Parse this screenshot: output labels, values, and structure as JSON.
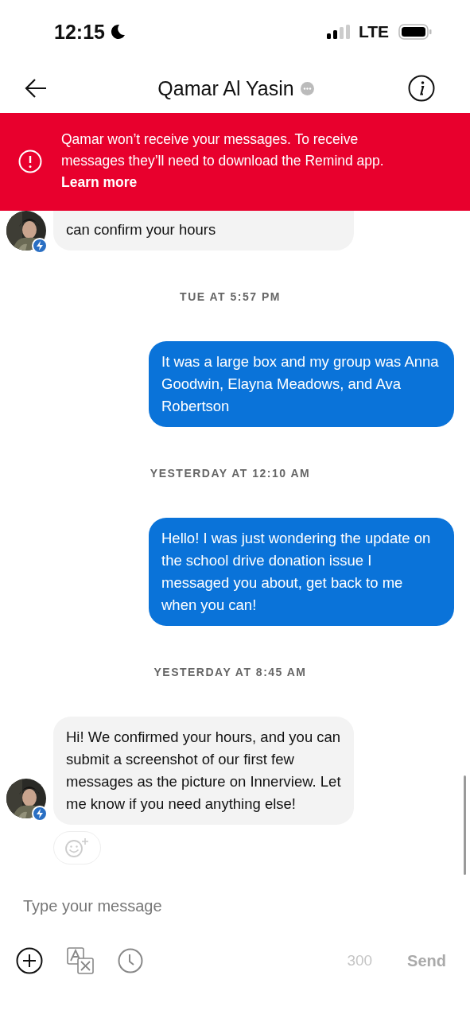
{
  "status_bar": {
    "time": "12:15",
    "network": "LTE"
  },
  "header": {
    "title": "Qamar Al Yasin"
  },
  "banner": {
    "text": "Qamar won’t receive your messages. To receive messages they’ll need to download the Remind app.",
    "link": "Learn more"
  },
  "messages": [
    {
      "kind": "incoming",
      "text": "can confirm your hours",
      "cut": true,
      "reaction_button": false
    },
    {
      "kind": "timestamp",
      "text": "TUE AT 5:57 PM"
    },
    {
      "kind": "outgoing",
      "text": "It was a large box and my group was Anna Goodwin, Elayna Meadows, and Ava Robertson"
    },
    {
      "kind": "timestamp",
      "text": "YESTERDAY AT 12:10 AM"
    },
    {
      "kind": "outgoing",
      "text": "Hello! I was just wondering the update on the school drive donation issue I messaged you about, get back to me when you can!"
    },
    {
      "kind": "timestamp",
      "text": "YESTERDAY AT 8:45 AM"
    },
    {
      "kind": "incoming",
      "text": "Hi! We confirmed your hours, and you can submit a screenshot of our first few messages as the picture on Innerview. Let me know if you need anything else!",
      "cut": false,
      "reaction_button": true
    }
  ],
  "composer": {
    "placeholder": "Type your message",
    "char_count": "300",
    "send": "Send",
    "send_disabled": true
  }
}
